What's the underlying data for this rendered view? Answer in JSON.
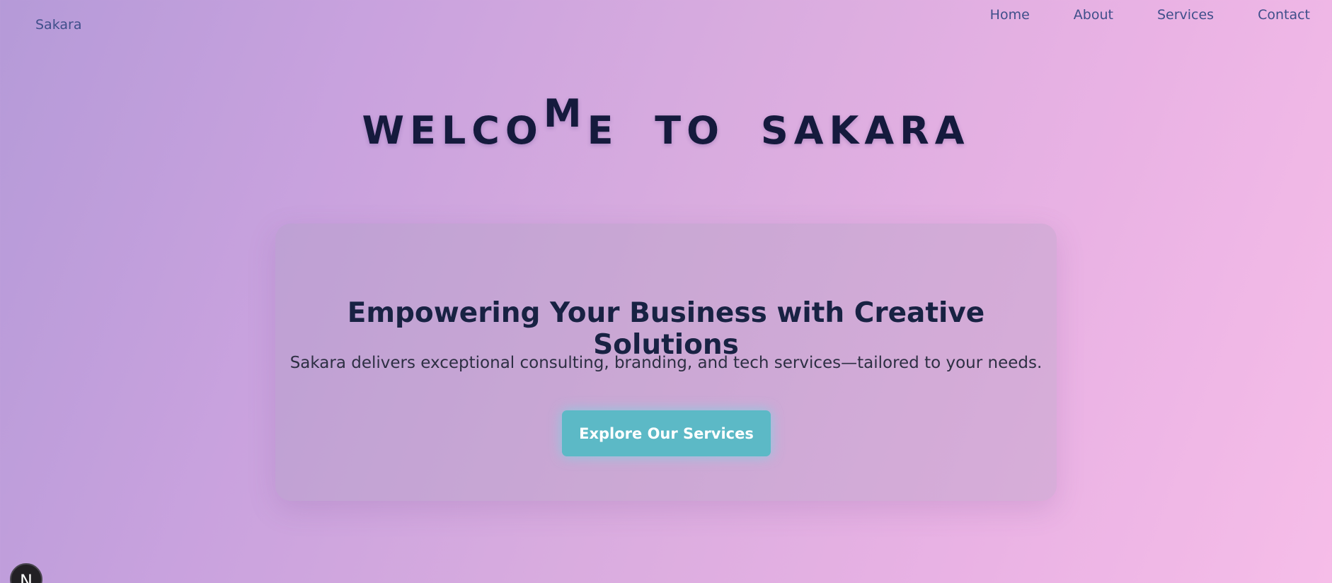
{
  "header": {
    "brand": "Sakara",
    "nav": [
      "Home",
      "About",
      "Services",
      "Contact"
    ]
  },
  "hero": {
    "title_part1": "WELCO",
    "title_lifted": "M",
    "title_part2": "E",
    "title_word2": "TO",
    "title_word3": "SAKARA"
  },
  "card": {
    "heading": "Empowering Your Business with Creative Solutions",
    "description": "Sakara delivers exceptional consulting, branding, and tech services—tailored to your needs.",
    "cta_label": "Explore Our Services"
  },
  "badge": {
    "letter": "N"
  },
  "colors": {
    "nav_text": "#3f4f8a",
    "title_text": "#151a3d",
    "cta_background": "#5cb9c6"
  }
}
